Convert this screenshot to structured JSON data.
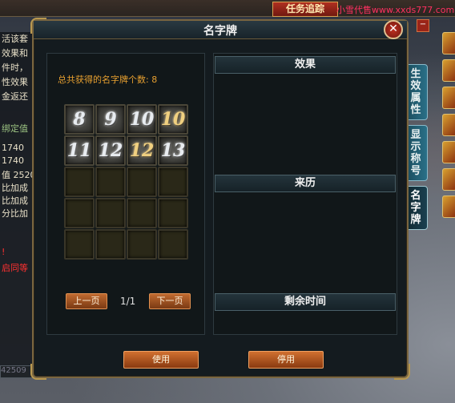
{
  "background": {
    "task_tracker_label": "任务追踪",
    "watermark": "小雪代售www.xxds777.com",
    "min_button": "−",
    "left_lines": [
      {
        "text": "活该套",
        "cls": ""
      },
      {
        "text": "效果和",
        "cls": ""
      },
      {
        "text": "件时，",
        "cls": ""
      },
      {
        "text": "性效果",
        "cls": ""
      },
      {
        "text": "金返还",
        "cls": ""
      },
      {
        "text": "绑定值",
        "cls": "green"
      },
      {
        "text": "1740",
        "cls": ""
      },
      {
        "text": "1740",
        "cls": ""
      },
      {
        "text": "值 2520",
        "cls": ""
      },
      {
        "text": "比加成",
        "cls": ""
      },
      {
        "text": "比加成",
        "cls": ""
      },
      {
        "text": "分比加",
        "cls": ""
      },
      {
        "text": "!",
        "cls": "red"
      },
      {
        "text": "启同等",
        "cls": "red"
      }
    ],
    "input_value": "42509",
    "side_tabs": [
      {
        "label": "生效属性",
        "active": false
      },
      {
        "label": "显示称号",
        "active": false
      },
      {
        "label": "名字牌",
        "active": true
      }
    ]
  },
  "window": {
    "title": "名字牌",
    "close_label": "✕",
    "count_text": "总共获得的名字牌个数: 8",
    "plates": [
      {
        "label": "8",
        "gold": false
      },
      {
        "label": "9",
        "gold": false
      },
      {
        "label": "10",
        "gold": false
      },
      {
        "label": "10",
        "gold": true
      },
      {
        "label": "11",
        "gold": false
      },
      {
        "label": "12",
        "gold": false
      },
      {
        "label": "12",
        "gold": true
      },
      {
        "label": "13",
        "gold": false
      }
    ],
    "empty_slots": 12,
    "prev_label": "上一页",
    "page_indicator": "1/1",
    "next_label": "下一页",
    "sections": {
      "effect": "效果",
      "origin": "来历",
      "remaining": "剩余时间"
    },
    "use_label": "使用",
    "disable_label": "停用"
  }
}
